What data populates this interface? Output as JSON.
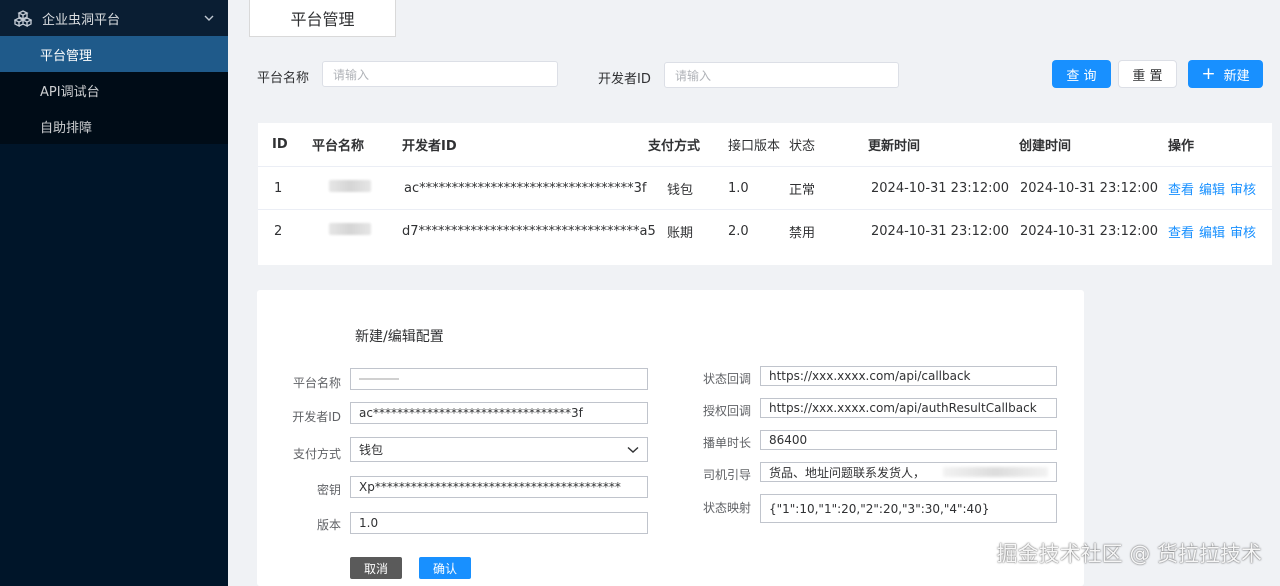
{
  "sidebar": {
    "app_title": "企业虫洞平台",
    "items": [
      {
        "label": "平台管理"
      },
      {
        "label": "API调试台"
      },
      {
        "label": "自助排障"
      }
    ]
  },
  "tab": {
    "label": "平台管理"
  },
  "filters": {
    "platform_name_label": "平台名称",
    "platform_name_placeholder": "请输入",
    "developer_id_label": "开发者ID",
    "developer_id_placeholder": "请输入"
  },
  "buttons": {
    "search": "查 询",
    "reset": "重 置",
    "create": "新建"
  },
  "table": {
    "headers": [
      "ID",
      "平台名称",
      "开发者ID",
      "支付方式",
      "接口版本",
      "状态",
      "更新时间",
      "创建时间",
      "操作"
    ],
    "rows": [
      {
        "id": "1",
        "developer_id": "ac*********************************3f",
        "payment": "钱包",
        "version": "1.0",
        "status": "正常",
        "updated": "2024-10-31  23:12:00",
        "created": "2024-10-31  23:12:00",
        "actions": [
          "查看",
          "编辑",
          "审核"
        ]
      },
      {
        "id": "2",
        "developer_id": "d7**********************************a5",
        "payment": "账期",
        "version": "2.0",
        "status": "禁用",
        "updated": "2024-10-31  23:12:00",
        "created": "2024-10-31  23:12:00",
        "actions": [
          "查看",
          "编辑",
          "审核"
        ]
      }
    ]
  },
  "form": {
    "title": "新建/编辑配置",
    "platform_name_label": "平台名称",
    "developer_id_label": "开发者ID",
    "developer_id_value": "ac*********************************3f",
    "payment_label": "支付方式",
    "payment_value": "钱包",
    "secret_label": "密钥",
    "secret_value": "Xp*****************************************",
    "version_label": "版本",
    "version_value": "1.0",
    "status_callback_label": "状态回调",
    "status_callback_value": "https://xxx.xxxx.com/api/callback",
    "auth_callback_label": "授权回调",
    "auth_callback_value": "https://xxx.xxxx.com/api/authResultCallback",
    "order_duration_label": "播单时长",
    "order_duration_value": "86400",
    "driver_guide_label": "司机引导",
    "driver_guide_value": "货品、地址问题联系发货人，",
    "status_map_label": "状态映射",
    "status_map_value": "{\"1\":10,\"1\":20,\"2\":20,\"3\":30,\"4\":40}",
    "cancel": "取消",
    "confirm": "确认"
  },
  "watermark": "掘金技术社区 @ 货拉拉技术",
  "colors": {
    "sidebar_bg": "#001529",
    "active_item": "#1f5a8a",
    "primary": "#1890ff"
  }
}
